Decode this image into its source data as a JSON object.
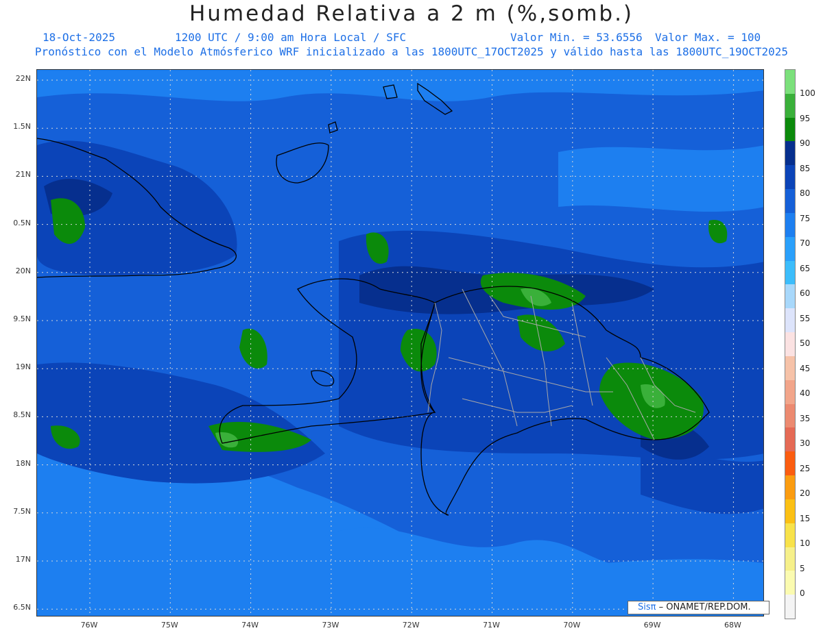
{
  "title": "Humedad Relativa a 2 m (%,somb.)",
  "subtitle": {
    "date": "18-Oct-2025",
    "time": "1200 UTC / 9:00 am Hora Local / SFC",
    "value_min": "Valor Min. = 53.6556",
    "value_max": "Valor Max. = 100",
    "model_line": "Pronóstico con el Modelo Atmósferico WRF inicializado a las 1800UTC_17OCT2025 y válido hasta las  1800UTC_19OCT2025"
  },
  "map": {
    "lat_labels": [
      "22N",
      "1.5N",
      "21N",
      "0.5N",
      "20N",
      "9.5N",
      "19N",
      "8.5N",
      "18N",
      "7.5N",
      "17N",
      "6.5N"
    ],
    "lon_labels": [
      "76W",
      "75W",
      "74W",
      "73W",
      "72W",
      "71W",
      "70W",
      "69W",
      "68W"
    ],
    "background_color": "#1560d8",
    "coastline_color": "#000000",
    "border_color": "#a8a8a8"
  },
  "colorbar": {
    "labels": [
      "100",
      "95",
      "90",
      "85",
      "80",
      "75",
      "70",
      "65",
      "60",
      "55",
      "50",
      "45",
      "40",
      "35",
      "30",
      "25",
      "20",
      "15",
      "10",
      "5",
      "0"
    ],
    "colors": [
      "#7be07b",
      "#3ab03a",
      "#0b8a0b",
      "#062f8e",
      "#0b44b8",
      "#1560d8",
      "#1d7ff0",
      "#2aa0fb",
      "#3cbdfb",
      "#a8d8fb",
      "#dde4fb",
      "#fbe2e2",
      "#f6c2a8",
      "#f2a58a",
      "#ec8a70",
      "#e56a55",
      "#fb5d10",
      "#fb9c10",
      "#fbc014",
      "#f8e24a",
      "#f6f08a",
      "#fbfbb0",
      "#f4f4f4"
    ]
  },
  "credit": {
    "brand": "Sisπ",
    "org": "– ONAMET/REP.DOM."
  }
}
